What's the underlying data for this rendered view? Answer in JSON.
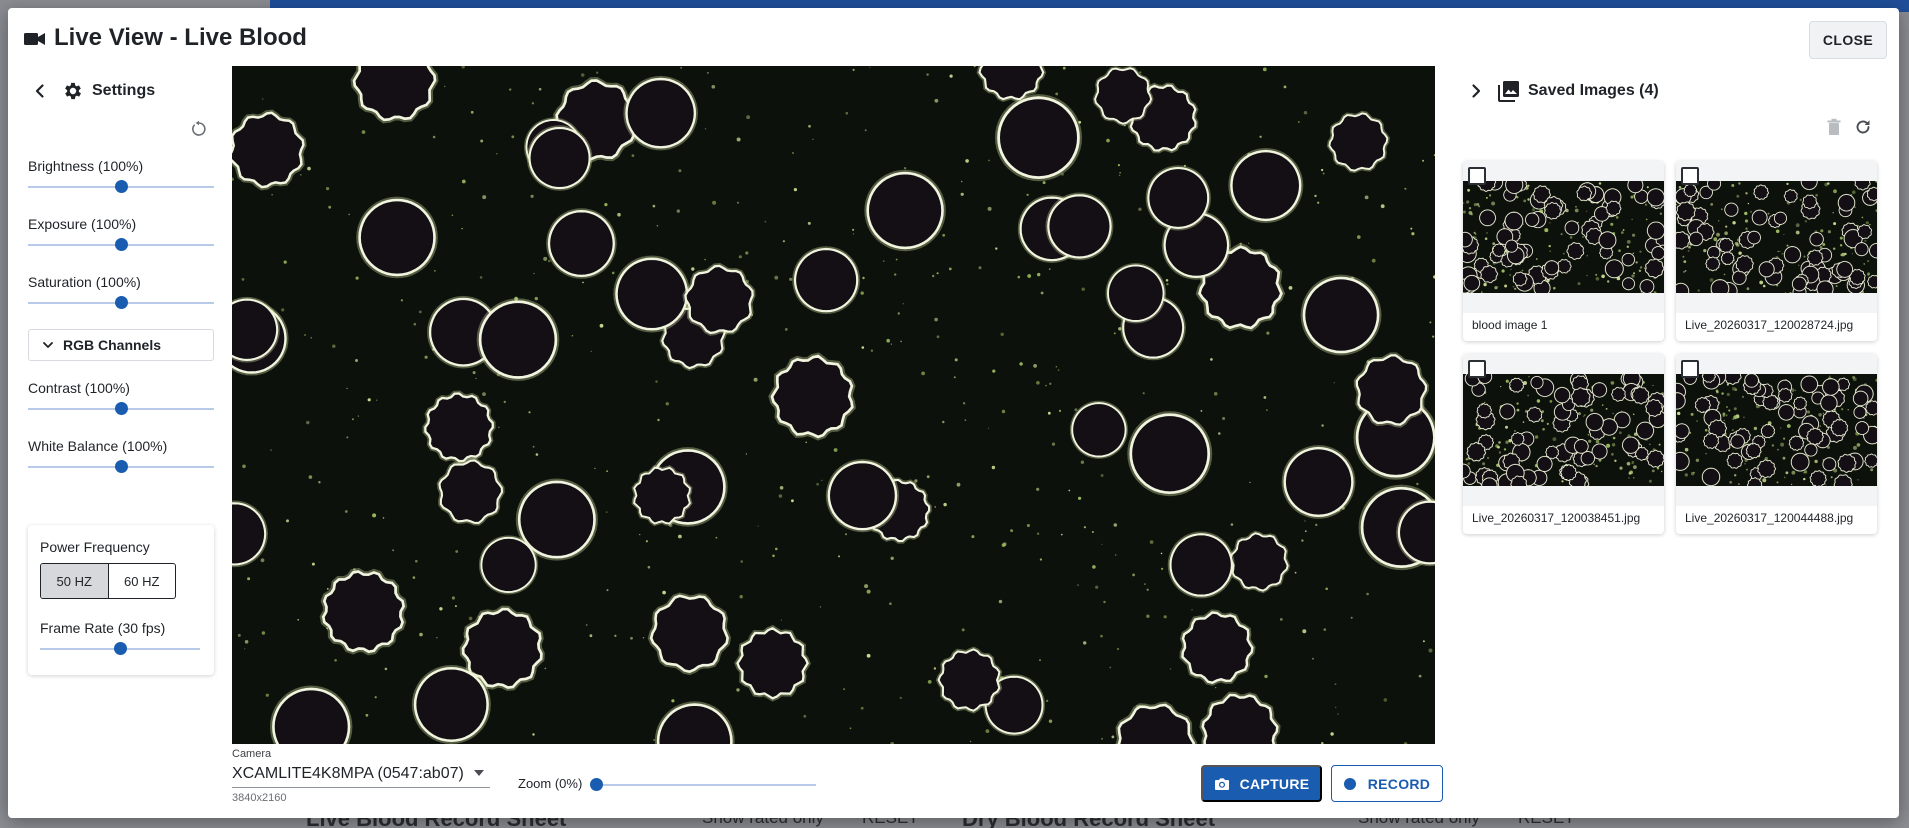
{
  "dialog": {
    "title": "Live View - Live Blood",
    "close_label": "CLOSE"
  },
  "settings": {
    "title": "Settings",
    "sliders": [
      {
        "label": "Brightness (100%)",
        "value_fraction": 0.5
      },
      {
        "label": "Exposure (100%)",
        "value_fraction": 0.5
      },
      {
        "label": "Saturation (100%)",
        "value_fraction": 0.5
      },
      {
        "label": "Contrast (100%)",
        "value_fraction": 0.5
      },
      {
        "label": "White Balance (100%)",
        "value_fraction": 0.5
      }
    ],
    "rgb_channels_label": "RGB Channels",
    "power_frequency": {
      "label": "Power Frequency",
      "options": [
        "50 HZ",
        "60 HZ"
      ],
      "selected": "50 HZ"
    },
    "frame_rate": {
      "label": "Frame Rate (30 fps)",
      "value_fraction": 0.5
    }
  },
  "camera": {
    "caption": "Camera",
    "selected": "XCAMLITE4K8MPA (0547:ab07)",
    "resolution": "3840x2160"
  },
  "zoom": {
    "label": "Zoom (0%)",
    "value_fraction": 0.0
  },
  "actions": {
    "capture_label": "CAPTURE",
    "record_label": "RECORD"
  },
  "saved_images": {
    "title": "Saved Images (4)",
    "items": [
      {
        "name": "blood image 1",
        "checked": false
      },
      {
        "name": "Live_20260317_120028724.jpg",
        "checked": false
      },
      {
        "name": "Live_20260317_120038451.jpg",
        "checked": false
      },
      {
        "name": "Live_20260317_120044488.jpg",
        "checked": false
      }
    ]
  },
  "background_page": {
    "left_title": "Live Blood Record Sheet",
    "left_toggle": "Show rated only",
    "left_reset": "RESET",
    "right_title": "Dry Blood Record Sheet",
    "right_toggle": "Show rated only",
    "right_reset": "RESET"
  },
  "colors": {
    "primary": "#1a5cb0",
    "track": "#b7cbe8",
    "live_background": "#0d110b",
    "cell_rim": "#f1f5df",
    "cell_glow": "#d7e6a6"
  },
  "icons": {
    "title": "videocam-icon",
    "settings": "gear-icon",
    "collapse_left": "chevron-left-icon",
    "expand_right": "chevron-right-icon",
    "reset": "reset-icon",
    "rgb_expand": "chevron-down-icon",
    "saved": "photo-library-icon",
    "delete": "trash-icon",
    "refresh": "refresh-icon",
    "capture": "camera-icon",
    "record": "record-dot-icon",
    "camera_select": "caret-down-icon"
  }
}
